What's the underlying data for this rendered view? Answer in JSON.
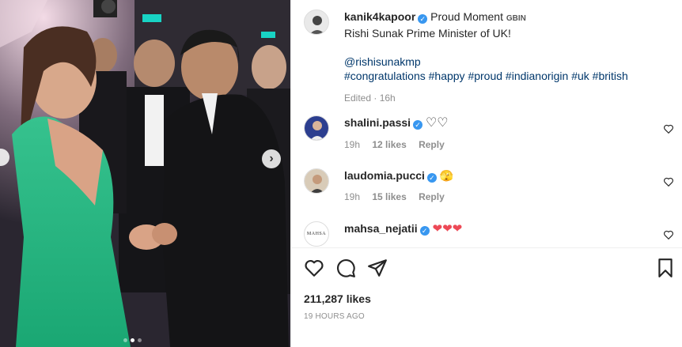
{
  "post": {
    "author": "kanik4kapoor",
    "caption_title": "Proud Moment",
    "caption_flag": "GBIN",
    "caption_line": "Rishi Sunak Prime Minister of UK!",
    "mention": "@rishisunakmp",
    "hashtags": "#congratulations #happy #proud #indianorigin #uk #british",
    "edited": "Edited · 16h"
  },
  "comments": [
    {
      "user": "shalini.passi",
      "text": "♡♡",
      "time": "19h",
      "likes": "12 likes",
      "reply": "Reply"
    },
    {
      "user": "laudomia.pucci",
      "text": "🫣",
      "time": "19h",
      "likes": "15 likes",
      "reply": "Reply"
    },
    {
      "user": "mahsa_nejatii",
      "text": "❤❤❤"
    }
  ],
  "mahsa_avatar_text": "MAHSA",
  "likes_total": "211,287 likes",
  "posted": "19 HOURS AGO",
  "media": {
    "current_slide": 2,
    "total_slides": 3
  },
  "colors": {
    "verified": "#3897f0",
    "link": "#00376b",
    "muted": "#8e8e8e",
    "heart": "#ed4956"
  },
  "icons": [
    "heart-icon",
    "comment-icon",
    "share-icon",
    "bookmark-icon",
    "verified-icon",
    "chevron-right-icon"
  ]
}
